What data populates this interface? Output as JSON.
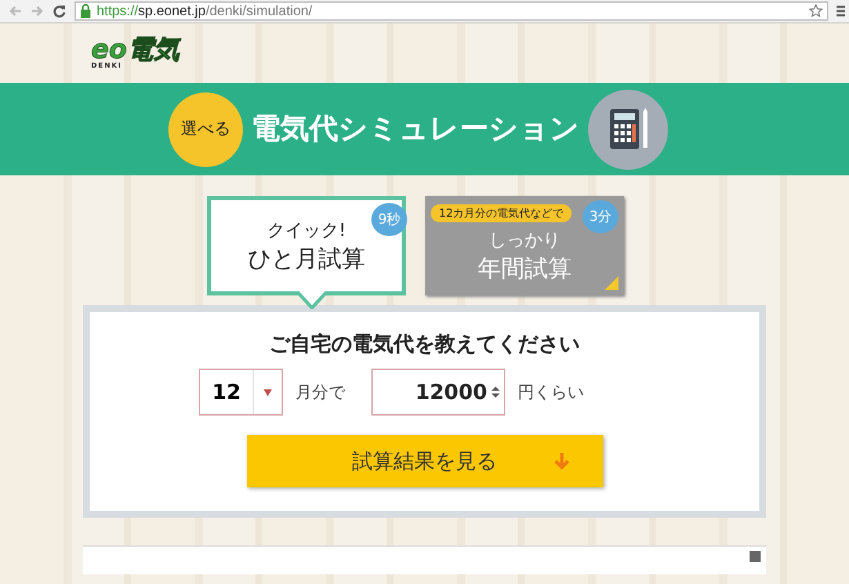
{
  "browser": {
    "url_scheme": "https://",
    "url_host": "sp.eonet.jp",
    "url_path": "/denki/simulation/"
  },
  "logo": {
    "text": "eo電気",
    "subtext": "DENKI"
  },
  "banner": {
    "badge": "選べる",
    "title": "電気代シミュレーション"
  },
  "tabs": [
    {
      "badge": "9秒",
      "lines": [
        "クイック!",
        "ひと月試算"
      ],
      "selected": true
    },
    {
      "badge": "3分",
      "note": "12カ月分の電気代などで",
      "lines": [
        "しっかり",
        "年間試算"
      ],
      "selected": false
    }
  ],
  "form": {
    "title": "ご自宅の電気代を教えてください",
    "month": "12",
    "month_suffix": "月分で",
    "amount": "12000",
    "amount_suffix": "円くらい",
    "submit": "試算結果を見る"
  }
}
